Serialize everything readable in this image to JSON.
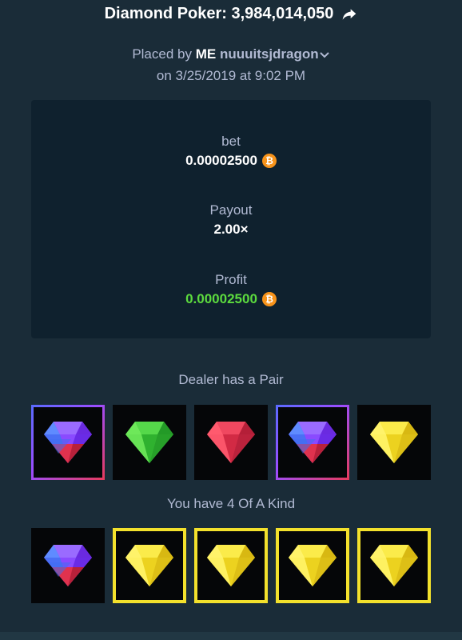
{
  "header": {
    "title": "Diamond Poker: 3,984,014,050",
    "placed_prefix": "Placed by",
    "badge": "ME",
    "username": "nuuuitsjdragon",
    "date": "on 3/25/2019 at 9:02 PM"
  },
  "stats": {
    "bet_label": "bet",
    "bet_value": "0.00002500",
    "payout_label": "Payout",
    "payout_value": "2.00×",
    "profit_label": "Profit",
    "profit_value": "0.00002500"
  },
  "dealer": {
    "label": "Dealer has a Pair",
    "cards": [
      "blue-red-gem",
      "green-gem",
      "red-gem",
      "blue-red-gem",
      "yellow-gem"
    ]
  },
  "player": {
    "label": "You have 4 Of A Kind",
    "cards": [
      "blue-red-gem",
      "yellow-gem",
      "yellow-gem",
      "yellow-gem",
      "yellow-gem"
    ]
  },
  "colors": {
    "background": "#1a2c38",
    "card_panel": "#0f212e",
    "profit_green": "#5cdb3e",
    "win_border": "#f3e12c",
    "bitcoin": "#f7931a"
  }
}
